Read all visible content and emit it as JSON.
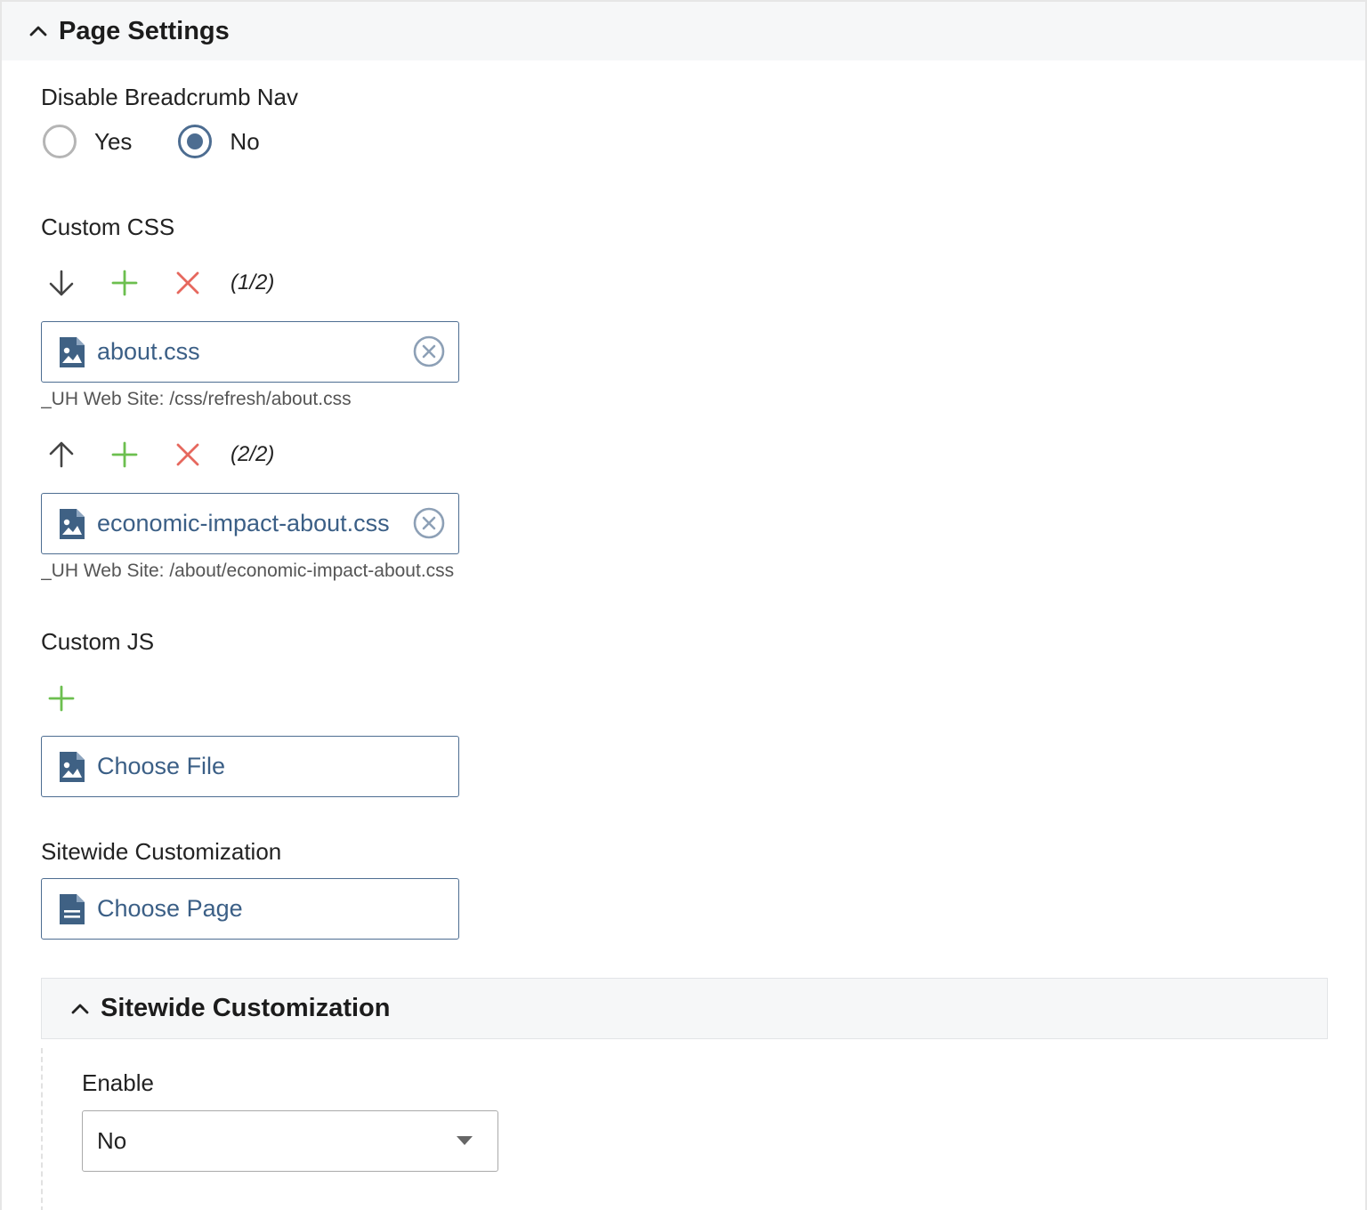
{
  "panel": {
    "title": "Page Settings"
  },
  "breadcrumb_nav": {
    "label": "Disable Breadcrumb Nav",
    "options": [
      {
        "label": "Yes",
        "selected": false
      },
      {
        "label": "No",
        "selected": true
      }
    ]
  },
  "custom_css": {
    "label": "Custom CSS",
    "items": [
      {
        "counter": "(1/2)",
        "file": "about.css",
        "path": "_UH Web Site: /css/refresh/about.css"
      },
      {
        "counter": "(2/2)",
        "file": "economic-impact-about.css",
        "path": "_UH Web Site: /about/economic-impact-about.css"
      }
    ]
  },
  "custom_js": {
    "label": "Custom JS",
    "button": "Choose File"
  },
  "sitewide_customization": {
    "label": "Sitewide Customization",
    "button": "Choose Page"
  },
  "sitewide_section": {
    "title": "Sitewide Customization",
    "enable_label": "Enable",
    "enable_value": "No"
  },
  "colors": {
    "accent": "#4d6d91",
    "add": "#6cbf4f",
    "remove": "#e6685e"
  }
}
